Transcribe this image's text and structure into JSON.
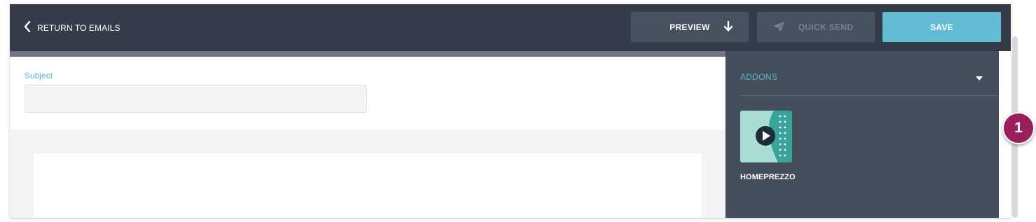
{
  "topbar": {
    "back_label": "RETURN TO EMAILS",
    "preview_label": "PREVIEW",
    "quick_send_label": "QUICK SEND",
    "save_label": "SAVE"
  },
  "editor": {
    "subject_label": "Subject",
    "subject_value": ""
  },
  "sidebar": {
    "addons_title": "ADDONS",
    "addons": [
      {
        "name": "HOMEPREZZO",
        "icon": "play-icon"
      }
    ]
  },
  "annotation": {
    "step_number": "1"
  },
  "colors": {
    "topbar": "#333c48",
    "sidebar": "#454f5c",
    "accent": "#63bcd4",
    "label_accent": "#52b8cf",
    "badge": "#9b1f5c",
    "addon_tile": "#3aa39a"
  }
}
